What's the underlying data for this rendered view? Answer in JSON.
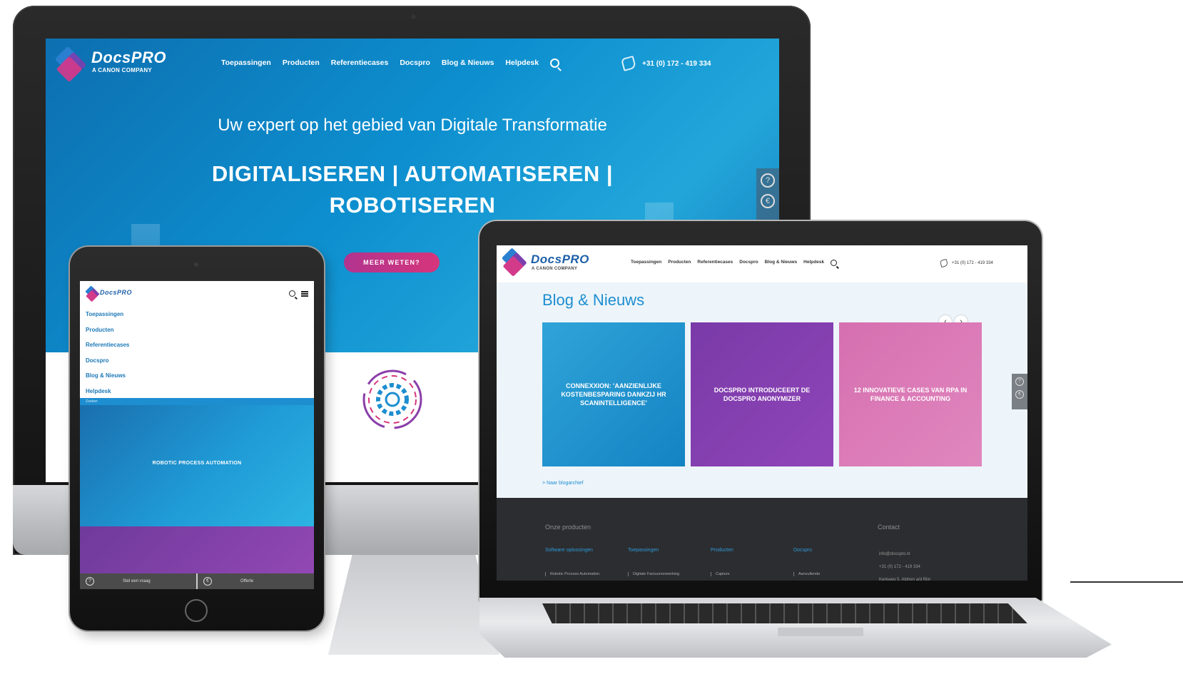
{
  "brand": {
    "name": "DocsPRO",
    "tagline": "A CANON COMPANY",
    "colors": {
      "blue": "#1d8ed0",
      "purple": "#7a3aa8",
      "pink": "#d6357b",
      "dark": "#2c2d30"
    }
  },
  "desktop": {
    "nav": [
      "Toepassingen",
      "Producten",
      "Referentiecases",
      "Docspro",
      "Blog & Nieuws",
      "Helpdesk"
    ],
    "phone": "+31 (0) 172 - 419 334",
    "hero_subtitle": "Uw expert op het gebied van Digitale Transformatie",
    "hero_title_line1": "DIGITALISEREN | AUTOMATISEREN |",
    "hero_title_line2": "ROBOTISEREN",
    "cta": "MEER WETEN?",
    "side_icons": [
      "question-icon",
      "coin-icon"
    ]
  },
  "tablet": {
    "menu": [
      "Toepassingen",
      "Producten",
      "Referentiecases",
      "Docspro",
      "Blog & Nieuws",
      "Helpdesk"
    ],
    "section_label": "Zoeken",
    "hero_title": "ROBOTIC PROCESS AUTOMATION",
    "footer_left": "Stel een vraag",
    "footer_right": "Offerte"
  },
  "laptop": {
    "nav": [
      "Toepassingen",
      "Producten",
      "Referentiecases",
      "Docspro",
      "Blog & Nieuws",
      "Helpdesk"
    ],
    "phone": "+31 (0) 172 - 419 334",
    "heading": "Blog & Nieuws",
    "cards": [
      "CONNEXXION: 'AANZIENLIJKE KOSTENBESPARING DANKZIJ HR SCANINTELLIGENCE'",
      "DOCSPRO INTRODUCEERT DE DOCSPRO ANONYMIZER",
      "12 INNOVATIEVE CASES VAN RPA IN FINANCE & ACCOUNTING"
    ],
    "archive_link": "> Naar blogarchief",
    "footer": {
      "products_title": "Onze producten",
      "contact_title": "Contact",
      "columns": [
        "Software oplossingen",
        "Toepassingen",
        "Producten",
        "Docspro"
      ],
      "rows": [
        "Robotic Process Automation",
        "Digitale Factuurverwerking",
        "Capture",
        "Aanvullende"
      ],
      "contact": [
        "info@docspro.nl",
        "+31 (0) 172 - 419 334",
        "Kerkweg 5, Alphen a/d Rijn"
      ]
    }
  }
}
